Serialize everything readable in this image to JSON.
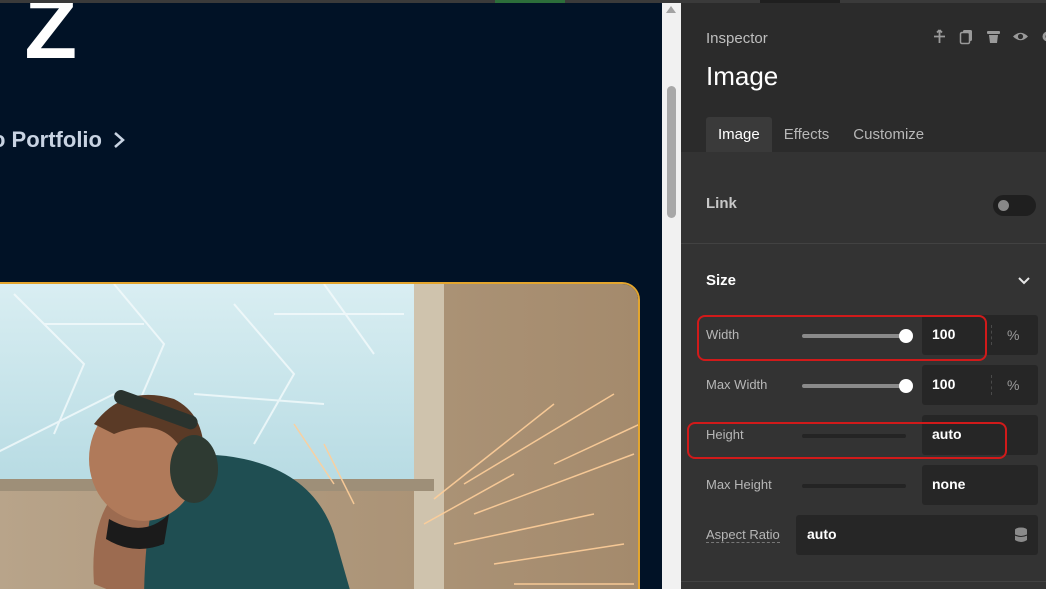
{
  "canvas": {
    "hero_title": "t Z",
    "portfolio_link": "o Portfolio",
    "image_alt": "Worker grinding metal with sparks, wearing headphones and a mask"
  },
  "inspector": {
    "label": "Inspector",
    "title": "Image",
    "header_icons": [
      "move-icon",
      "duplicate-icon",
      "trash-icon",
      "eye-icon",
      "gear-icon"
    ],
    "tabs": [
      {
        "label": "Image",
        "active": true
      },
      {
        "label": "Effects",
        "active": false
      },
      {
        "label": "Customize",
        "active": false
      }
    ],
    "link": {
      "label": "Link",
      "enabled": false
    },
    "size": {
      "heading": "Size",
      "width": {
        "label": "Width",
        "value": "100",
        "unit": "%",
        "slider_fraction": 1.0
      },
      "max_width": {
        "label": "Max Width",
        "value": "100",
        "unit": "%",
        "slider_fraction": 1.0
      },
      "height": {
        "label": "Height",
        "value": "auto"
      },
      "max_height": {
        "label": "Max Height",
        "value": "none"
      },
      "aspect_ratio": {
        "label": "Aspect Ratio",
        "value": "auto"
      }
    }
  },
  "colors": {
    "canvas_bg": "#011226",
    "image_border": "#e3a52e",
    "highlight": "#d11a1a",
    "panel_bg": "#333333"
  }
}
